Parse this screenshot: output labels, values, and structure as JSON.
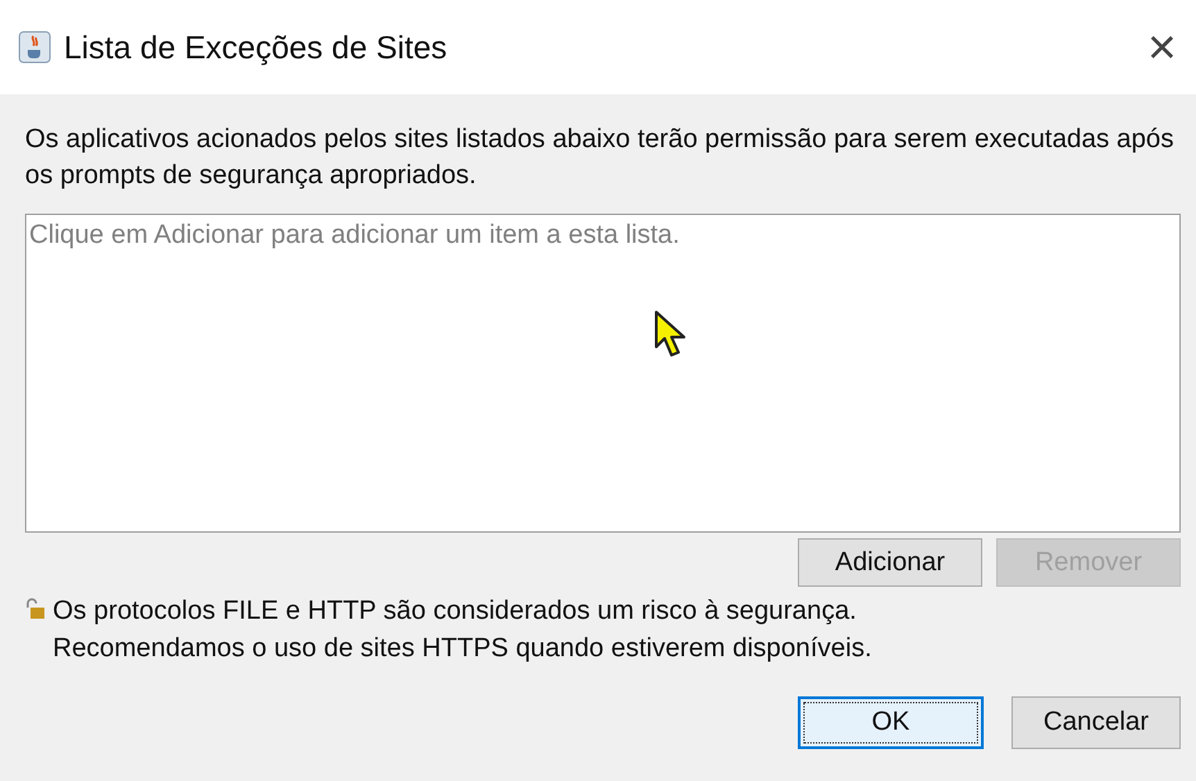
{
  "window": {
    "title": "Lista de Exceções de Sites",
    "close": "×"
  },
  "description": "Os aplicativos acionados pelos sites listados abaixo terão permissão para serem executadas após os prompts de segurança apropriados.",
  "list": {
    "placeholder": "Clique em Adicionar para adicionar um item a esta lista."
  },
  "list_buttons": [
    {
      "label": "Adicionar",
      "disabled": false
    },
    {
      "label": "Remover",
      "disabled": true
    }
  ],
  "warning": [
    "Os protocolos FILE e HTTP são considerados um risco à segurança.",
    "Recomendamos o uso de sites HTTPS quando estiverem disponíveis."
  ],
  "dialog_buttons": [
    {
      "label": "OK",
      "focused": true
    },
    {
      "label": "Cancelar",
      "focused": false
    }
  ]
}
